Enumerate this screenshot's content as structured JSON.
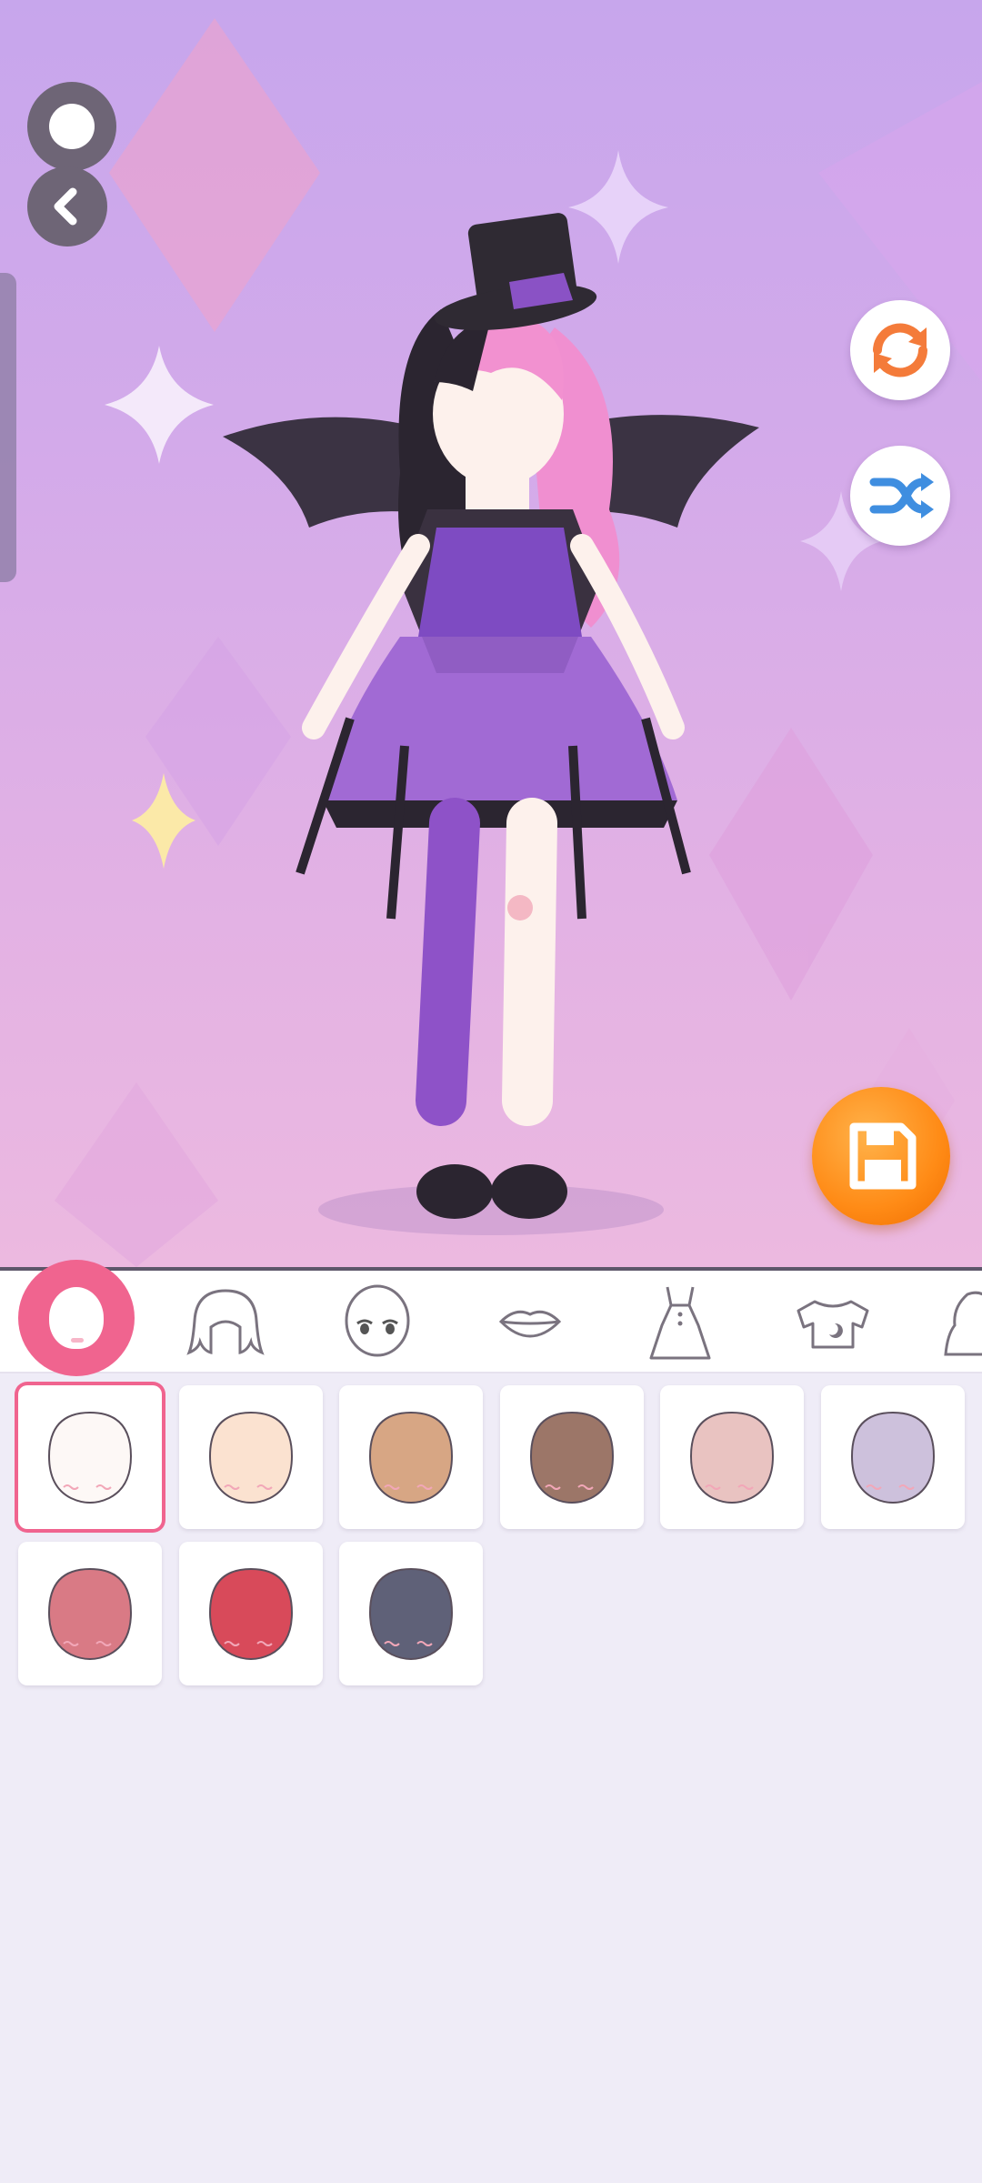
{
  "colors": {
    "accent_pink": "#f0648f",
    "save_orange": "#ff8b16",
    "reset_orange": "#f47b3a",
    "shuffle_blue": "#3f8ee0"
  },
  "top_controls": [
    {
      "name": "menu-button",
      "icon": "circle-icon"
    },
    {
      "name": "back-button",
      "icon": "chevron-left-icon"
    }
  ],
  "side_controls": [
    {
      "name": "reset-button",
      "icon": "refresh-icon"
    },
    {
      "name": "shuffle-button",
      "icon": "shuffle-icon"
    },
    {
      "name": "save-button",
      "icon": "floppy-disk-icon"
    }
  ],
  "category_tabs": [
    {
      "id": "face",
      "icon": "face-shape-icon",
      "active": true
    },
    {
      "id": "hair",
      "icon": "hair-icon",
      "active": false
    },
    {
      "id": "eyes",
      "icon": "eyes-icon",
      "active": false
    },
    {
      "id": "mouth",
      "icon": "lips-icon",
      "active": false
    },
    {
      "id": "dress",
      "icon": "dress-icon",
      "active": false
    },
    {
      "id": "top",
      "icon": "shirt-icon",
      "active": false
    },
    {
      "id": "more",
      "icon": "partial-icon",
      "active": false
    }
  ],
  "skin_tones": [
    {
      "color": "#fdf8f6",
      "selected": true
    },
    {
      "color": "#fbe2d0",
      "selected": false
    },
    {
      "color": "#d7a684",
      "selected": false
    },
    {
      "color": "#9c7668",
      "selected": false
    },
    {
      "color": "#e9c3c1",
      "selected": false
    },
    {
      "color": "#cdc1dc",
      "selected": false
    },
    {
      "color": "#d97a85",
      "selected": false
    },
    {
      "color": "#d84a5a",
      "selected": false
    },
    {
      "color": "#5f6178",
      "selected": false
    }
  ]
}
